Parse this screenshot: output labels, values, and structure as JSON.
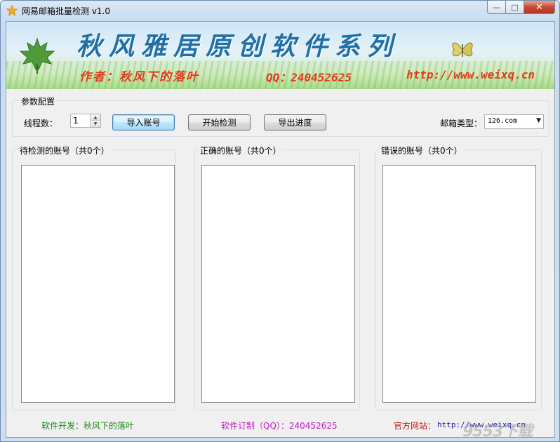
{
  "window": {
    "title": "网易邮箱批量检测 v1.0",
    "close_label": "✕",
    "maximize_label": "□",
    "minimize_label": "—"
  },
  "banner": {
    "title": "秋风雅居原创软件系列",
    "author": "作者：秋风下的落叶",
    "qq": "QQ：240452625",
    "url": "http://www.weixq.cn"
  },
  "config": {
    "group_title": "参数配置",
    "threads_label": "线程数：",
    "threads_value": "1",
    "import_button": "导入账号",
    "start_button": "开始检测",
    "export_button": "导出进度",
    "mail_type_label": "邮箱类型：",
    "mail_type_value": "126.com"
  },
  "lists": {
    "pending_title": "待检测的账号（共0个）",
    "correct_title": "正确的账号（共0个）",
    "error_title": "错误的账号（共0个）"
  },
  "footer": {
    "developer": "软件开发：秋风下的落叶",
    "custom": "软件订制（QQ）：240452625",
    "website_label": "官方网站：",
    "website_url": "http://www.weixq.cn",
    "watermark": "9553下载"
  },
  "colors": {
    "developer": "#1a8a1a",
    "custom": "#c21ac2",
    "website_label": "#c81818",
    "banner_title": "#1f6fa8",
    "banner_accent": "#e23a1a"
  }
}
